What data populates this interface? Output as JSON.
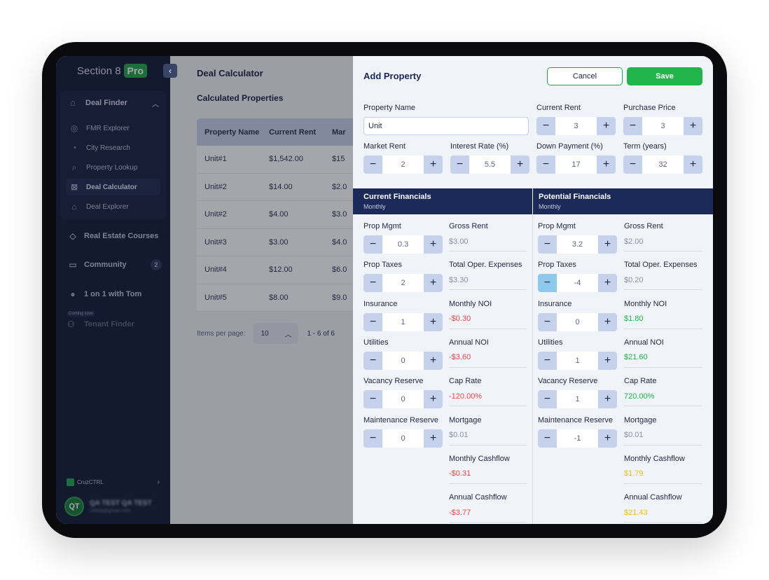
{
  "sidebar": {
    "brand": "Section 8",
    "brand_badge": "Pro",
    "group": {
      "label": "Deal Finder",
      "items": [
        {
          "label": "FMR Explorer",
          "icon": "user-location-icon"
        },
        {
          "label": "City Research",
          "icon": "pie-chart-icon"
        },
        {
          "label": "Property Lookup",
          "icon": "search-icon"
        },
        {
          "label": "Deal Calculator",
          "icon": "calculator-icon",
          "active": true
        },
        {
          "label": "Deal Explorer",
          "icon": "home-icon"
        }
      ]
    },
    "items": [
      {
        "label": "Real Estate Courses",
        "icon": "graduation-cap-icon"
      },
      {
        "label": "Community",
        "icon": "chat-icon",
        "badge": "2"
      },
      {
        "label": "1 on 1 with Tom",
        "icon": "avatar-photo-icon"
      }
    ],
    "coming_soon": "Coming soon",
    "tenant": "Tenant Finder",
    "org": "CruzCTRL",
    "user": {
      "initials": "QT",
      "name": "QA TEST QA TEST",
      "email": "1ffddq@gmail.com"
    }
  },
  "main": {
    "title": "Deal Calculator",
    "section": "Calculated Properties",
    "columns": [
      "Property Name",
      "Current Rent",
      "Mar"
    ],
    "rows": [
      [
        "Unit#1",
        "$1,542.00",
        "$15"
      ],
      [
        "Unit#2",
        "$14.00",
        "$2.0"
      ],
      [
        "Unit#2",
        "$4.00",
        "$3.0"
      ],
      [
        "Unit#3",
        "$3.00",
        "$4.0"
      ],
      [
        "Unit#4",
        "$12.00",
        "$6.0"
      ],
      [
        "Unit#5",
        "$8.00",
        "$9.0"
      ]
    ],
    "pager": {
      "label": "Items per page:",
      "value": "10",
      "range": "1 - 6 of 6"
    }
  },
  "panel": {
    "title": "Add Property",
    "cancel": "Cancel",
    "save": "Save",
    "property_name_label": "Property Name",
    "property_name_value": "Unit",
    "fields": {
      "current_rent": {
        "label": "Current Rent",
        "value": "3"
      },
      "purchase_price": {
        "label": "Purchase Price",
        "value": "3"
      },
      "market_rent": {
        "label": "Market Rent",
        "value": "2"
      },
      "interest_rate": {
        "label": "Interest Rate (%)",
        "value": "5.5"
      },
      "down_payment": {
        "label": "Down Payment (%)",
        "value": "17"
      },
      "term": {
        "label": "Term (years)",
        "value": "32"
      }
    },
    "current": {
      "title": "Current Financials",
      "subtitle": "Monthly",
      "inputs": [
        {
          "label": "Prop Mgmt",
          "value": "0.3"
        },
        {
          "label": "Prop Taxes",
          "value": "2"
        },
        {
          "label": "Insurance",
          "value": "1"
        },
        {
          "label": "Utilities",
          "value": "0"
        },
        {
          "label": "Vacancy Reserve",
          "value": "0"
        },
        {
          "label": "Maintenance Reserve",
          "value": "0"
        }
      ],
      "metrics": [
        {
          "label": "Gross Rent",
          "value": "$3.00",
          "color": "gray"
        },
        {
          "label": "Total Oper. Expenses",
          "value": "$3.30",
          "color": "gray"
        },
        {
          "label": "Monthly NOI",
          "value": "-$0.30",
          "color": "red"
        },
        {
          "label": "Annual NOI",
          "value": "-$3.60",
          "color": "red"
        },
        {
          "label": "Cap Rate",
          "value": "-120.00%",
          "color": "red"
        },
        {
          "label": "Mortgage",
          "value": "$0.01",
          "color": "gray"
        },
        {
          "label": "Monthly Cashflow",
          "value": "-$0.31",
          "color": "red"
        },
        {
          "label": "Annual Cashflow",
          "value": "-$3.77",
          "color": "red"
        }
      ]
    },
    "potential": {
      "title": "Potential Financials",
      "subtitle": "Monthly",
      "inputs": [
        {
          "label": "Prop Mgmt",
          "value": "3.2"
        },
        {
          "label": "Prop Taxes",
          "value": "-4"
        },
        {
          "label": "Insurance",
          "value": "0"
        },
        {
          "label": "Utilities",
          "value": "1"
        },
        {
          "label": "Vacancy Reserve",
          "value": "1"
        },
        {
          "label": "Maintenance Reserve",
          "value": "-1"
        }
      ],
      "metrics": [
        {
          "label": "Gross Rent",
          "value": "$2.00",
          "color": "gray"
        },
        {
          "label": "Total Oper. Expenses",
          "value": "$0.20",
          "color": "gray"
        },
        {
          "label": "Monthly NOI",
          "value": "$1.80",
          "color": "green"
        },
        {
          "label": "Annual NOI",
          "value": "$21.60",
          "color": "green"
        },
        {
          "label": "Cap Rate",
          "value": "720.00%",
          "color": "green"
        },
        {
          "label": "Mortgage",
          "value": "$0.01",
          "color": "gray"
        },
        {
          "label": "Monthly Cashflow",
          "value": "$1.79",
          "color": "yellow"
        },
        {
          "label": "Annual Cashflow",
          "value": "$21.43",
          "color": "yellow"
        }
      ]
    }
  }
}
